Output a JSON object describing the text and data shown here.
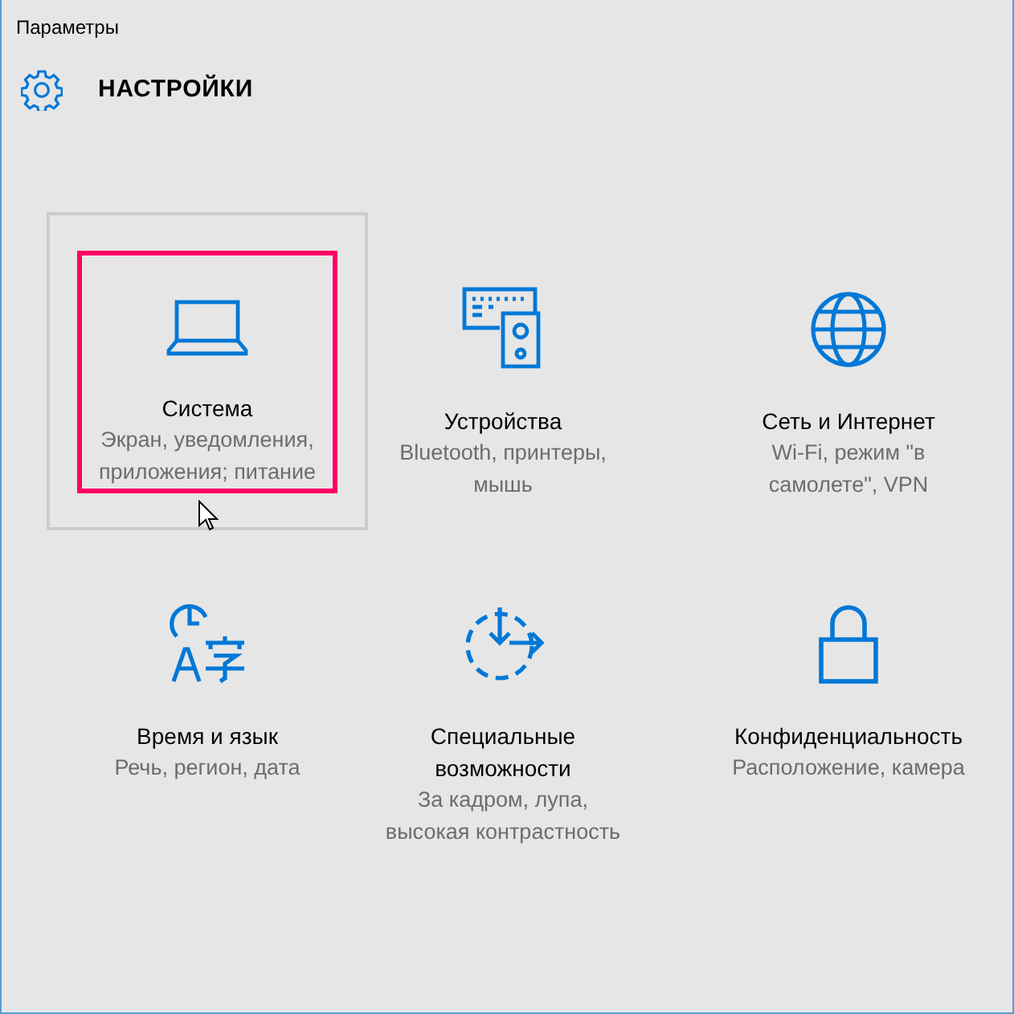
{
  "window": {
    "title": "Параметры"
  },
  "header": {
    "title": "НАСТРОЙКИ"
  },
  "tiles": [
    {
      "title": "Система",
      "subtitle": "Экран, уведомления, приложения; питание",
      "selected": true
    },
    {
      "title": "Устройства",
      "subtitle": "Bluetooth, принтеры, мышь",
      "selected": false
    },
    {
      "title": "Сеть и Интернет",
      "subtitle": "Wi-Fi, режим \"в самолете\", VPN",
      "selected": false
    },
    {
      "title": "Время и язык",
      "subtitle": "Речь, регион, дата",
      "selected": false
    },
    {
      "title": "Специальные возможности",
      "subtitle": "За кадром, лупа, высокая контрастность",
      "selected": false
    },
    {
      "title": "Конфиденциальность",
      "subtitle": "Расположение, камера",
      "selected": false
    }
  ]
}
